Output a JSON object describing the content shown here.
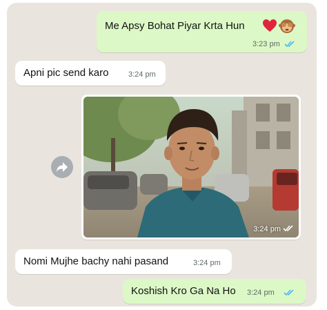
{
  "messages": [
    {
      "direction": "outgoing",
      "text": "Me Apsy Bohat Piyar Krta Hun",
      "emoji": [
        "red-heart",
        "see-no-evil-monkey"
      ],
      "time": "3:23 pm",
      "status": "read"
    },
    {
      "direction": "incoming",
      "text": "Apni pic send karo",
      "time": "3:24 pm"
    },
    {
      "direction": "outgoing",
      "type": "photo",
      "time": "3:24 pm",
      "status": "read"
    },
    {
      "direction": "incoming",
      "text": "Nomi Mujhe bachy nahi pasand",
      "time": "3:24 pm"
    },
    {
      "direction": "outgoing",
      "text": "Koshish Kro Ga Na Ho",
      "time": "3:24 pm",
      "status": "read"
    }
  ],
  "icons": {
    "forward": "forward-arrow-icon",
    "read_receipt": "double-check-icon"
  },
  "colors": {
    "chat_bg": "#e9e5de",
    "outgoing_bubble": "#dcf8c6",
    "incoming_bubble": "#ffffff",
    "read_ticks": "#4fb6ec"
  }
}
